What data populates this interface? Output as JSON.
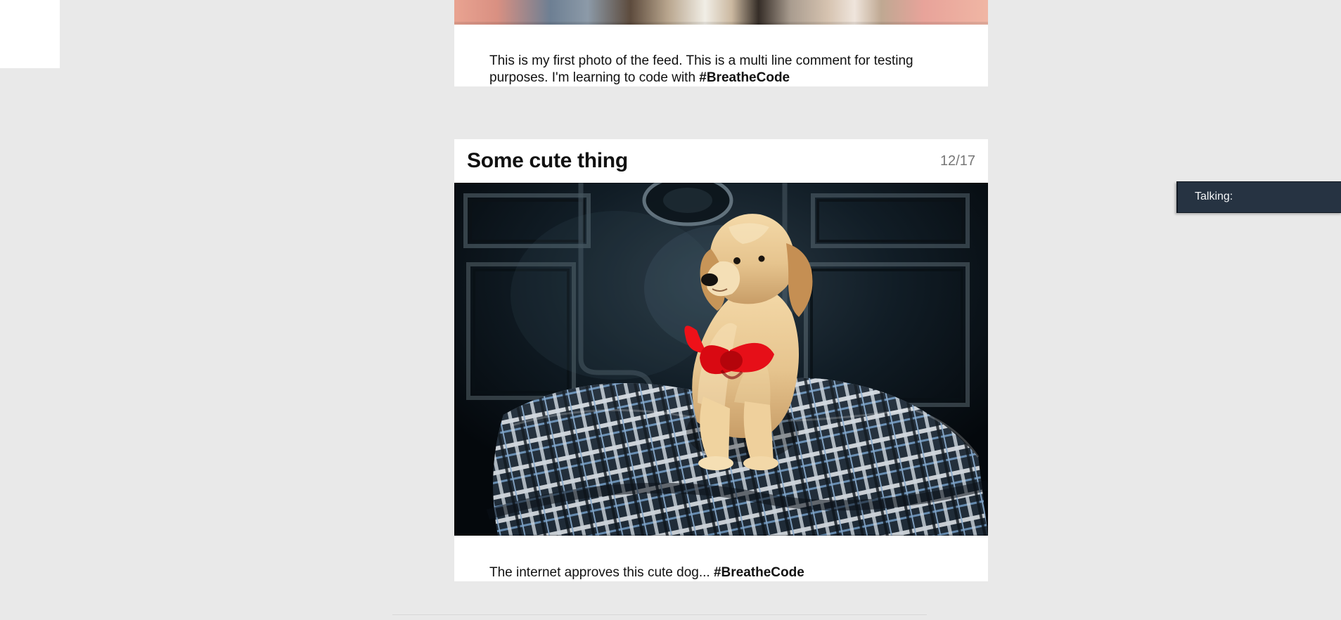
{
  "feed": {
    "posts": [
      {
        "caption_text": "This is my first photo of the feed. This is a multi line comment for testing purposes. I'm learning to code with ",
        "hashtag": "#BreatheCode"
      },
      {
        "title": "Some cute thing",
        "counter": "12/17",
        "image_alt": "Golden retriever puppy with red bow on plaid cushion",
        "caption_text": "The internet approves this cute dog... ",
        "hashtag": "#BreatheCode"
      }
    ]
  },
  "talking_panel": {
    "label": "Talking:"
  },
  "colors": {
    "background": "#e9e9e9",
    "card": "#ffffff",
    "title": "#111111",
    "counter": "#777777",
    "talking_panel": "#263342"
  }
}
